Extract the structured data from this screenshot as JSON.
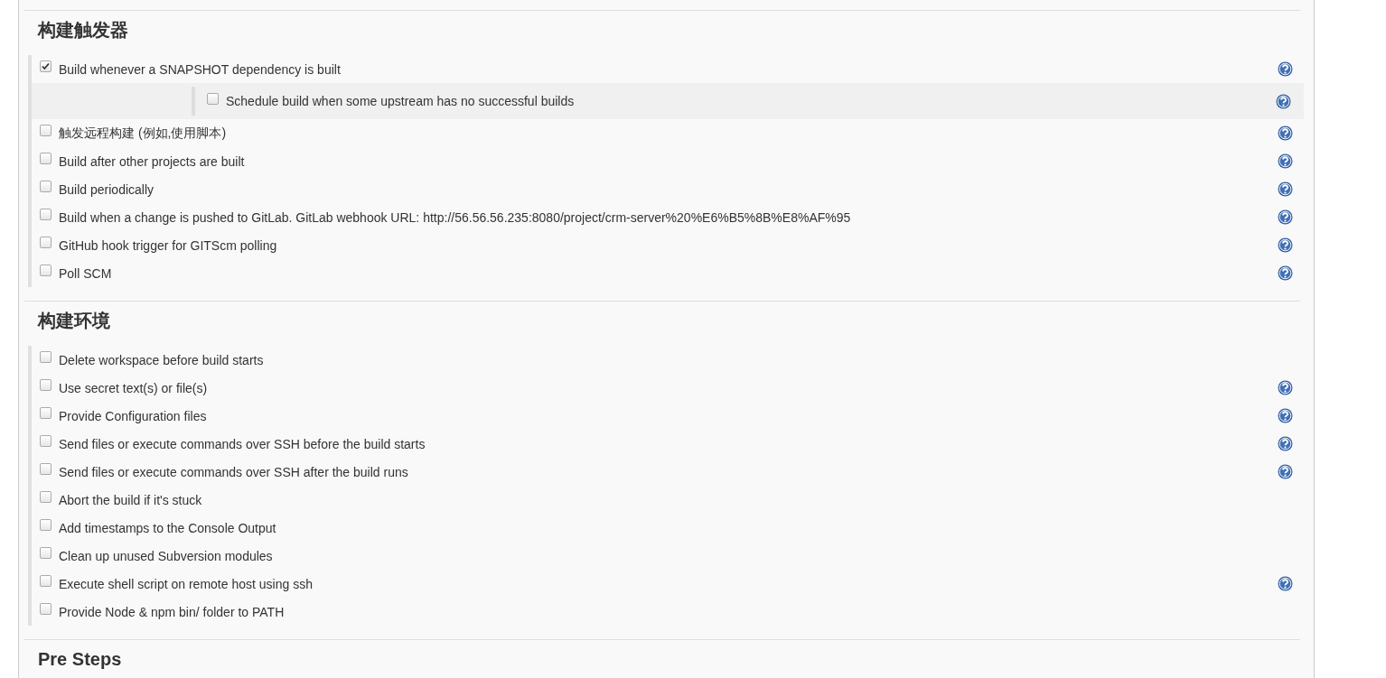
{
  "sections": [
    {
      "title": "构建触发器",
      "items": [
        {
          "label": "Build whenever a SNAPSHOT dependency is built",
          "checked": true,
          "help": true,
          "children": [
            {
              "label": "Schedule build when some upstream has no successful builds",
              "checked": false,
              "help": true
            }
          ]
        },
        {
          "label": "触发远程构建 (例如,使用脚本)",
          "checked": false,
          "help": true
        },
        {
          "label": "Build after other projects are built",
          "checked": false,
          "help": true
        },
        {
          "label": "Build periodically",
          "checked": false,
          "help": true
        },
        {
          "label": "Build when a change is pushed to GitLab. GitLab webhook URL: http://56.56.56.235:8080/project/crm-server%20%E6%B5%8B%E8%AF%95",
          "checked": false,
          "help": true
        },
        {
          "label": "GitHub hook trigger for GITScm polling",
          "checked": false,
          "help": true
        },
        {
          "label": "Poll SCM",
          "checked": false,
          "help": true
        }
      ]
    },
    {
      "title": "构建环境",
      "items": [
        {
          "label": "Delete workspace before build starts",
          "checked": false,
          "help": false
        },
        {
          "label": "Use secret text(s) or file(s)",
          "checked": false,
          "help": true
        },
        {
          "label": "Provide Configuration files",
          "checked": false,
          "help": true
        },
        {
          "label": "Send files or execute commands over SSH before the build starts",
          "checked": false,
          "help": true
        },
        {
          "label": "Send files or execute commands over SSH after the build runs",
          "checked": false,
          "help": true
        },
        {
          "label": "Abort the build if it's stuck",
          "checked": false,
          "help": false
        },
        {
          "label": "Add timestamps to the Console Output",
          "checked": false,
          "help": false
        },
        {
          "label": "Clean up unused Subversion modules",
          "checked": false,
          "help": false
        },
        {
          "label": "Execute shell script on remote host using ssh",
          "checked": false,
          "help": true
        },
        {
          "label": "Provide Node & npm bin/ folder to PATH",
          "checked": false,
          "help": false
        }
      ]
    },
    {
      "title": "Pre Steps"
    }
  ]
}
